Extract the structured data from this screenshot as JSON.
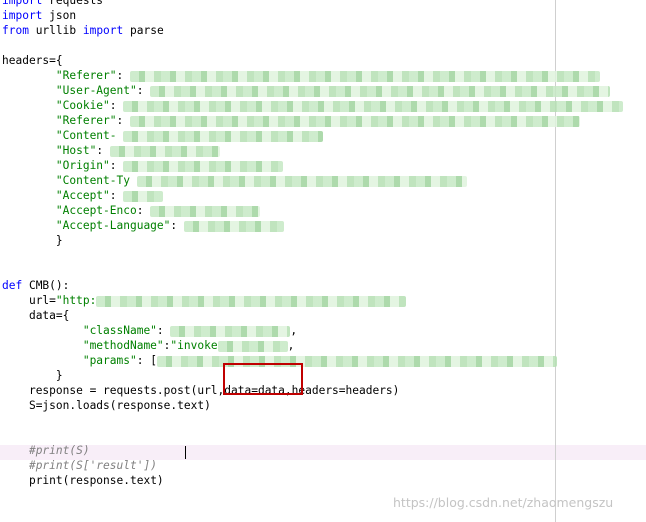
{
  "code": {
    "l1_kw": "import",
    "l1_mod": " requests",
    "l2_kw": "import",
    "l2_mod": " json",
    "l3_from": "from",
    "l3_mod": " urllib ",
    "l3_import": "import",
    "l3_name": " parse",
    "headers_open": "headers={",
    "k_referer": "\"Referer\"",
    "k_useragent": "\"User-Agent\"",
    "k_cookie": "\"Cookie\"",
    "k_referer2": "\"Referer\"",
    "k_content": "\"Content-",
    "k_host": "\"Host\"",
    "k_origin": "\"Origin\"",
    "k_contentty": "\"Content-Ty",
    "k_accept": "\"Accept\"",
    "k_acceptenc": "\"Accept-Enco",
    "k_acceptlang": "\"Accept-Language\"",
    "brace_close": "}",
    "def_kw": "def",
    "def_sig": " CMB():",
    "url_assign": "url=",
    "url_str": "\"http:",
    "data_open": "data={",
    "k_classname": "\"className\"",
    "k_methodname": "\"methodName\"",
    "methodname_val": "\"invoke",
    "k_params": "\"params\"",
    "params_open": ": [",
    "response_line_a": "response = requests.post(url",
    "response_line_b": ",data=data,",
    "response_line_c": "headers=headers)",
    "s_line": "S=json.loads(response.text)",
    "cmt_1": "#print(S)",
    "cmt_2": "#print(S['result'])",
    "print_line": "print(response.text)"
  },
  "watermark": "https://blog.csdn.net/zhaomengszu",
  "colors": {
    "keyword": "#0000ff",
    "string": "#008000",
    "comment": "#808080",
    "highlight_box": "#c00000"
  }
}
